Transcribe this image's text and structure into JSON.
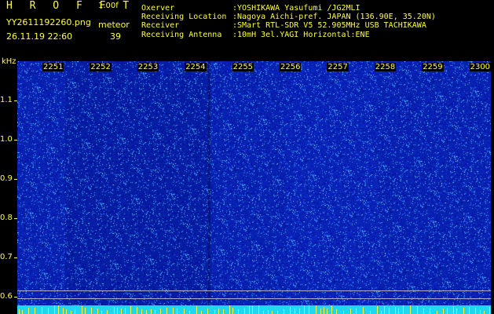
{
  "header": {
    "title": "H R O F F T",
    "version": "1.00f",
    "filename": "YY2611192260.png",
    "meteor_label": "meteor",
    "datetime": "26.11.19 22:60",
    "meteor_count": "39"
  },
  "info": [
    {
      "key": "Oxerver",
      "value": ":YOSHIKAWA Yasufumi /JG2MLI"
    },
    {
      "key": "Receiving Location",
      "value": ":Nagoya Aichi-pref. JAPAN (136.90E, 35.20N)"
    },
    {
      "key": "Receiver",
      "value": ":SMart RTL-SDR V5 52.905MHz USB TACHIKAWA"
    },
    {
      "key": "Receiving Antenna",
      "value": ":10mH 3el.YAGI Horizontal:ENE"
    }
  ],
  "axis": {
    "unit": "kHz",
    "y_ticks": [
      "1.1",
      "1.0",
      "0.9",
      "0.8",
      "0.7",
      "0.6"
    ],
    "x_ticks": [
      "2251",
      "2252",
      "2253",
      "2254",
      "2255",
      "2256",
      "2257",
      "2258",
      "2259",
      "2300"
    ]
  },
  "colors": {
    "background": "#000000",
    "label": "#ffff33",
    "noise_dark": "#0a0a8c",
    "noise_light": "#2b4dff",
    "baseline": "#1fd8f0"
  }
}
